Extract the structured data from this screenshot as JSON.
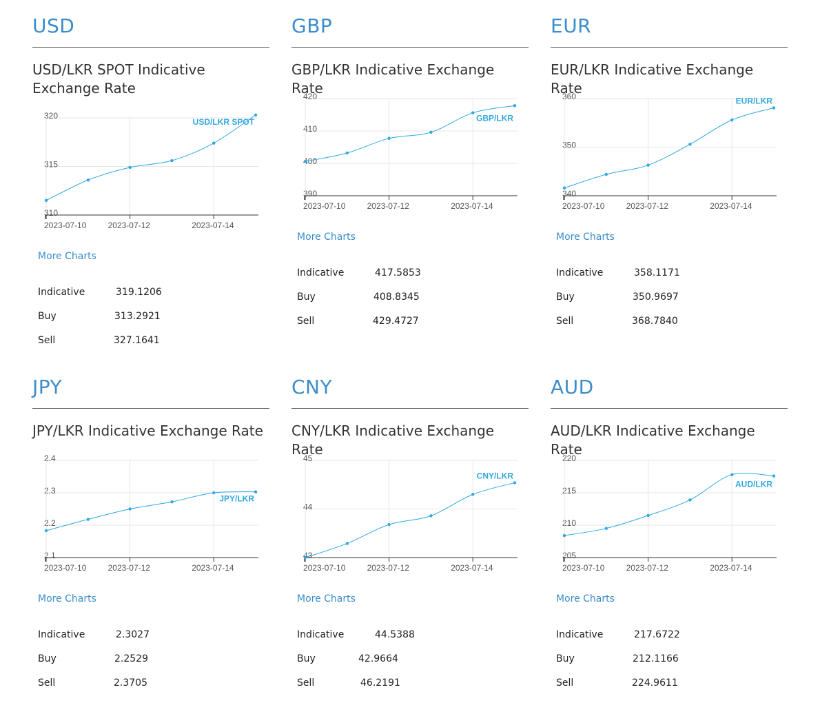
{
  "colors": {
    "accent": "#3c8dcb",
    "line": "#2fa8e0",
    "grid": "#e6e6e6",
    "axis": "#333333"
  },
  "panels": [
    {
      "code": "USD",
      "chart_title": "USD/LKR SPOT Indicative Exchange Rate",
      "more_label": "More Charts",
      "rates": [
        {
          "label": "Indicative",
          "value": "319.1206"
        },
        {
          "label": "Buy",
          "value": "313.2921"
        },
        {
          "label": "Sell",
          "value": "327.1641"
        }
      ]
    },
    {
      "code": "GBP",
      "chart_title": "GBP/LKR Indicative Exchange Rate",
      "more_label": "More Charts",
      "rates": [
        {
          "label": "Indicative",
          "value": "417.5853"
        },
        {
          "label": "Buy",
          "value": "408.8345"
        },
        {
          "label": "Sell",
          "value": "429.4727"
        }
      ]
    },
    {
      "code": "EUR",
      "chart_title": "EUR/LKR Indicative Exchange Rate",
      "more_label": "More Charts",
      "rates": [
        {
          "label": "Indicative",
          "value": "358.1171"
        },
        {
          "label": "Buy",
          "value": "350.9697"
        },
        {
          "label": "Sell",
          "value": "368.7840"
        }
      ]
    },
    {
      "code": "JPY",
      "chart_title": "JPY/LKR Indicative Exchange Rate",
      "more_label": "More Charts",
      "rates": [
        {
          "label": "Indicative",
          "value": "2.3027"
        },
        {
          "label": "Buy",
          "value": "2.2529"
        },
        {
          "label": "Sell",
          "value": "2.3705"
        }
      ]
    },
    {
      "code": "CNY",
      "chart_title": "CNY/LKR Indicative Exchange Rate",
      "more_label": "More Charts",
      "rates": [
        {
          "label": "Indicative",
          "value": "44.5388"
        },
        {
          "label": "Buy",
          "value": "42.9664"
        },
        {
          "label": "Sell",
          "value": "46.2191"
        }
      ]
    },
    {
      "code": "AUD",
      "chart_title": "AUD/LKR Indicative Exchange Rate",
      "more_label": "More Charts",
      "rates": [
        {
          "label": "Indicative",
          "value": "217.6722"
        },
        {
          "label": "Buy",
          "value": "212.1166"
        },
        {
          "label": "Sell",
          "value": "224.9611"
        }
      ]
    }
  ],
  "chart_data": [
    {
      "type": "line",
      "series_label": "USD/LKR SPOT",
      "x": [
        "2023-07-10",
        "2023-07-11",
        "2023-07-12",
        "2023-07-13",
        "2023-07-14",
        "2023-07-15"
      ],
      "x_ticks": [
        "2023-07-10",
        "2023-07-12",
        "2023-07-14"
      ],
      "y": [
        311.5,
        313.6,
        314.9,
        315.6,
        317.4,
        320.3
      ],
      "ylim": [
        310,
        320
      ],
      "y_ticks": [
        "310",
        "315",
        "320"
      ],
      "grid": true,
      "label_position": "top-right"
    },
    {
      "type": "line",
      "series_label": "GBP/LKR",
      "x": [
        "2023-07-10",
        "2023-07-11",
        "2023-07-12",
        "2023-07-13",
        "2023-07-14",
        "2023-07-15"
      ],
      "x_ticks": [
        "2023-07-10",
        "2023-07-12",
        "2023-07-14"
      ],
      "y": [
        400.6,
        403.2,
        407.7,
        409.6,
        415.6,
        417.8
      ],
      "ylim": [
        390,
        420
      ],
      "y_ticks": [
        "390",
        "400",
        "410",
        "420"
      ],
      "grid": true,
      "label_position": "top-right"
    },
    {
      "type": "line",
      "series_label": "EUR/LKR",
      "x": [
        "2023-07-10",
        "2023-07-11",
        "2023-07-12",
        "2023-07-13",
        "2023-07-14",
        "2023-07-15"
      ],
      "x_ticks": [
        "2023-07-10",
        "2023-07-12",
        "2023-07-14"
      ],
      "y": [
        341.6,
        344.4,
        346.3,
        350.6,
        355.6,
        358.1
      ],
      "ylim": [
        340,
        360
      ],
      "y_ticks": [
        "340",
        "350",
        "360"
      ],
      "grid": true,
      "label_position": "top-right"
    },
    {
      "type": "line",
      "series_label": "JPY/LKR",
      "x": [
        "2023-07-10",
        "2023-07-11",
        "2023-07-12",
        "2023-07-13",
        "2023-07-14",
        "2023-07-15"
      ],
      "x_ticks": [
        "2023-07-10",
        "2023-07-12",
        "2023-07-14"
      ],
      "y": [
        2.183,
        2.218,
        2.25,
        2.272,
        2.3,
        2.303
      ],
      "ylim": [
        2.1,
        2.4
      ],
      "y_ticks": [
        "2.1",
        "2.2",
        "2.3",
        "2.4"
      ],
      "grid": true,
      "label_position": "right"
    },
    {
      "type": "line",
      "series_label": "CNY/LKR",
      "x": [
        "2023-07-10",
        "2023-07-11",
        "2023-07-12",
        "2023-07-13",
        "2023-07-14",
        "2023-07-15"
      ],
      "x_ticks": [
        "2023-07-10",
        "2023-07-12",
        "2023-07-14"
      ],
      "y": [
        43.0,
        43.29,
        43.68,
        43.86,
        44.3,
        44.54
      ],
      "ylim": [
        43,
        45
      ],
      "y_ticks": [
        "43",
        "44",
        "45"
      ],
      "grid": true,
      "label_position": "top-right"
    },
    {
      "type": "line",
      "series_label": "AUD/LKR",
      "x": [
        "2023-07-10",
        "2023-07-11",
        "2023-07-12",
        "2023-07-13",
        "2023-07-14",
        "2023-07-15"
      ],
      "x_ticks": [
        "2023-07-10",
        "2023-07-12",
        "2023-07-14"
      ],
      "y": [
        208.4,
        209.5,
        211.5,
        213.9,
        217.8,
        217.6
      ],
      "ylim": [
        205,
        220
      ],
      "y_ticks": [
        "205",
        "210",
        "215",
        "220"
      ],
      "grid": true,
      "label_position": "top-right"
    }
  ]
}
